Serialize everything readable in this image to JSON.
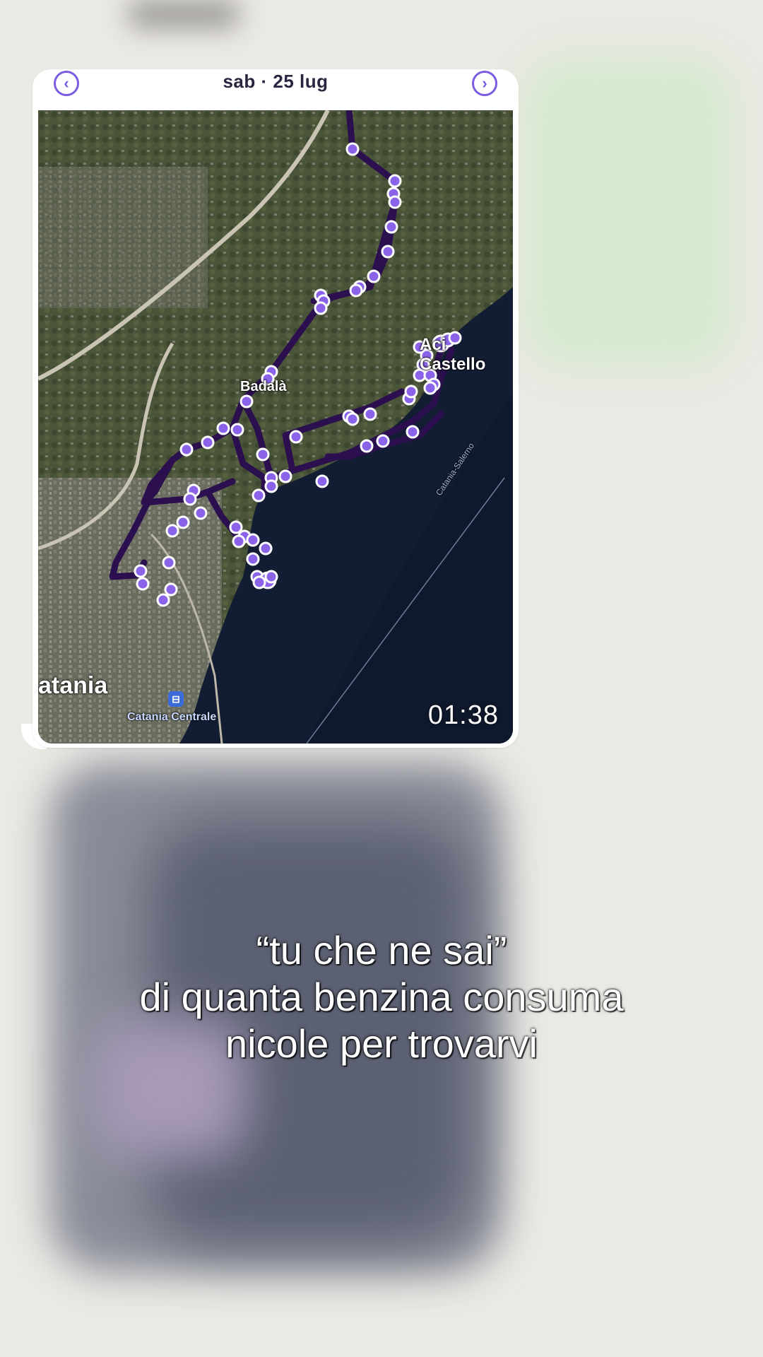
{
  "message": {
    "map_card": {
      "date": "sab · 25 lug",
      "prev_icon": "chevron-left-circle-icon",
      "next_icon": "chevron-right-circle-icon",
      "labels": {
        "badala": "Badalà",
        "aci_castello": "Aci Castello",
        "catania": "atania",
        "catania_centrale": "Catania Centrale",
        "road": "Catania-Salerno"
      },
      "timestamp": "01:38",
      "route_color": "#2b0f4e",
      "point_color": "#8a63e8"
    }
  },
  "caption": {
    "line1": "“tu che ne sai”",
    "line2": "di quanta benzina consuma",
    "line3": "nicole per trovarvi"
  },
  "colors": {
    "background": "#ebe9e4",
    "sea": "#121d33",
    "land": "#5b5f4a"
  }
}
